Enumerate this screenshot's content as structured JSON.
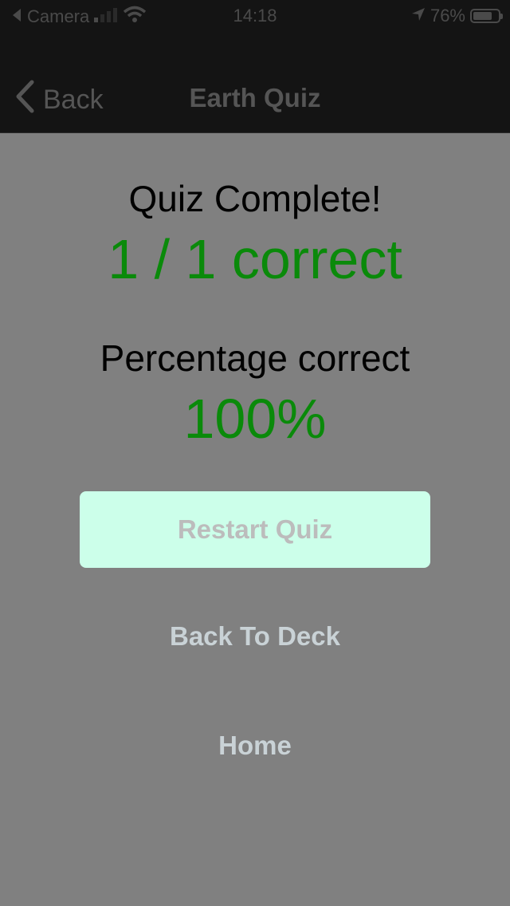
{
  "status_bar": {
    "back_app": "Camera",
    "time": "14:18",
    "battery": "76%",
    "battery_level": 0.76
  },
  "nav": {
    "back_label": "Back",
    "title": "Earth Quiz"
  },
  "quiz": {
    "complete_title": "Quiz Complete!",
    "score": "1 / 1 correct",
    "percentage_label": "Percentage correct",
    "percentage_value": "100%"
  },
  "actions": {
    "restart_label": "Restart Quiz",
    "back_to_deck_label": "Back To Deck",
    "home_label": "Home"
  },
  "colors": {
    "background": "#808080",
    "bar": "#141414",
    "success": "#0a8a0a",
    "restart_button": "#ccffea",
    "link_text": "#c9d2d6"
  }
}
